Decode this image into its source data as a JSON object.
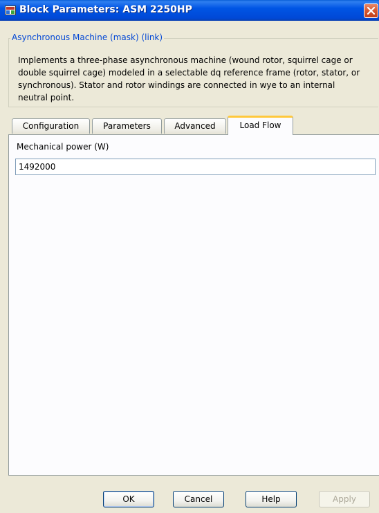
{
  "window": {
    "title": "Block Parameters: ASM 2250HP",
    "icon": "simulink-block-icon",
    "close_icon": "close-icon"
  },
  "mask": {
    "legend": "Asynchronous Machine (mask) (link)",
    "description_lines": [
      "Implements a three-phase asynchronous machine (wound rotor, squirrel cage or",
      "double squirrel cage) modeled in a selectable dq reference frame (rotor, stator, or",
      "synchronous). Stator and rotor windings are connected in wye to an internal",
      "neutral point."
    ]
  },
  "tabs": [
    {
      "label": "Configuration",
      "active": false
    },
    {
      "label": "Parameters",
      "active": false
    },
    {
      "label": "Advanced",
      "active": false
    },
    {
      "label": "Load Flow",
      "active": true
    }
  ],
  "load_flow": {
    "mechanical_power_label": "Mechanical power (W)",
    "mechanical_power_value": "1492000"
  },
  "buttons": {
    "ok": "OK",
    "cancel": "Cancel",
    "help": "Help",
    "apply": "Apply"
  },
  "colors": {
    "titlebar": "#0055e5",
    "active_tab_accent": "#ffc83c",
    "legend_text": "#0046d5"
  }
}
